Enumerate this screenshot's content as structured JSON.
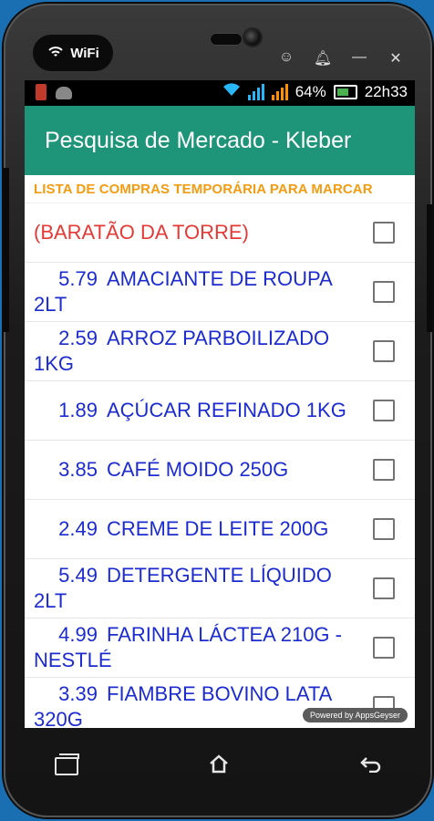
{
  "device": {
    "wifi_label": "WiFi"
  },
  "status": {
    "battery": "64%",
    "time": "22h33"
  },
  "app": {
    "title": "Pesquisa de Mercado - Kleber",
    "subheader": "LISTA DE COMPRAS TEMPORÁRIA PARA MARCAR"
  },
  "items": [
    {
      "price": "",
      "name": "(BARATÃO DA TORRE)",
      "checked": false
    },
    {
      "price": "5.79",
      "name": "AMACIANTE DE ROUPA 2LT",
      "checked": false
    },
    {
      "price": "2.59",
      "name": "ARROZ PARBOILIZADO 1KG",
      "checked": false
    },
    {
      "price": "1.89",
      "name": "AÇÚCAR REFINADO 1KG",
      "checked": false
    },
    {
      "price": "3.85",
      "name": "CAFÉ MOIDO 250G",
      "checked": false
    },
    {
      "price": "2.49",
      "name": "CREME DE LEITE 200G",
      "checked": false
    },
    {
      "price": "5.49",
      "name": "DETERGENTE LÍQUIDO 2LT",
      "checked": false
    },
    {
      "price": "4.99",
      "name": "FARINHA LÁCTEA 210G - NESTLÉ",
      "checked": false
    },
    {
      "price": "3.39",
      "name": "FIAMBRE BOVINO LATA 320G",
      "checked": false
    }
  ],
  "footer": {
    "powered_by": "Powered by AppsGeyser"
  },
  "icons": {
    "wifi": "wifi-icon",
    "ghost": "ghost-icon",
    "bell": "bell-icon",
    "minimize": "minimize-icon",
    "close": "close-icon",
    "recent": "recent-apps-icon",
    "home": "home-icon",
    "back": "back-icon"
  }
}
